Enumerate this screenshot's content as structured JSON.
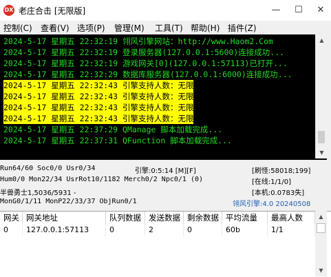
{
  "window": {
    "icon_text": "DX",
    "title": "老庄合击 [无限版]",
    "minimize": "—",
    "maximize": "☐",
    "close": "✕"
  },
  "menu": [
    "控制(C)",
    "查看(V)",
    "选项(P)",
    "管理(M)",
    "工具(T)",
    "帮助(H)",
    "插件(Z)"
  ],
  "log": [
    {
      "text": "2024-5-17 星期五 22:32:19 翎风引擎网站：http://www.Haom2.Com",
      "highlight": false
    },
    {
      "text": "2024-5-17 星期五 22:32:19 登录服务器(127.0.0.1:5600)连接成功...",
      "highlight": false
    },
    {
      "text": "2024-5-17 星期五 22:32:19 游戏网关[0](127.0.0.1:57113)已打开...",
      "highlight": false
    },
    {
      "text": "2024-5-17 星期五 22:32:29 数据库服务器(127.0.0.1:6000)连接成功...",
      "highlight": false
    },
    {
      "text": "2024-5-17 星期五 22:32:43 引擎支持人数：无限",
      "highlight": true
    },
    {
      "text": "2024-5-17 星期五 22:32:43 引擎支持人数：无限",
      "highlight": true
    },
    {
      "text": "2024-5-17 星期五 22:32:43 引擎支持人数：无限",
      "highlight": true
    },
    {
      "text": "2024-5-17 星期五 22:32:43 引擎支持人数：无限",
      "highlight": true
    },
    {
      "text": "2024-5-17 星期五 22:37:29 QManage 脚本加载完成...",
      "highlight": false
    },
    {
      "text": "2024-5-17 星期五 22:37:31 QFunction 脚本加载完成...",
      "highlight": false
    }
  ],
  "status": {
    "run": "Run64/60 Soc0/0 Usr0/34",
    "engine": "引擎:0:5:14 [M][F]",
    "refresh": "[刷怪:58018;199]",
    "hum": "Hum0/0 Mon22/34 UsrRot10/1182 Merch0/2 Npc0/1 (0)",
    "online": "[在线:1/1/0]",
    "player": "半兽勇士1,5036/5931 -",
    "local": "[本机:0.0783失]",
    "mongo": "MonG0/1/11 MonP22/33/37 ObjRun0/1",
    "version": "翎风引擎:4.0 20240508",
    "version_color": "#1f5fb4"
  },
  "grid": {
    "headers": [
      "网关",
      "网关地址",
      "队列数据",
      "发送数据",
      "剩余数据",
      "平均流量",
      "最高人数"
    ],
    "rows": [
      [
        "0",
        "127.0.0.1:57113",
        "0",
        "2",
        "0",
        "60b",
        "1/1"
      ]
    ]
  },
  "colors": {
    "log_bg": "#000000",
    "log_text": "#22dd22",
    "highlight_bg": "#ffff00",
    "highlight_text": "#000000"
  }
}
